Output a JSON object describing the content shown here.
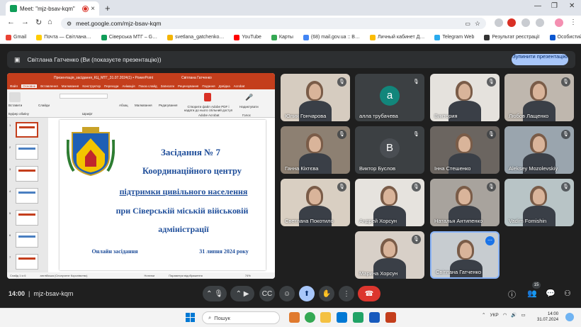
{
  "browser": {
    "tab_title": "Meet: \"mjz-bsav-kqm\"",
    "url": "meet.google.com/mjz-bsav-kqm",
    "new_tab": "+",
    "close": "×"
  },
  "bookmarks": [
    {
      "label": "Gmail",
      "color": "#ea4335"
    },
    {
      "label": "Почта — Світлана…",
      "color": "#ffcc00"
    },
    {
      "label": "Сіверська МТГ – G…",
      "color": "#0f9d58"
    },
    {
      "label": "svetlana_gatchenko…",
      "color": "#f4b400"
    },
    {
      "label": "YouTube",
      "color": "#ff0000"
    },
    {
      "label": "Карты",
      "color": "#34a853"
    },
    {
      "label": "(68) mail.gov.ua :: B…",
      "color": "#4285f4"
    },
    {
      "label": "Личный кабинет Д…",
      "color": "#fbbc04"
    },
    {
      "label": "Telegram Web",
      "color": "#2aabee"
    },
    {
      "label": "Результат реєстрації",
      "color": "#333333"
    },
    {
      "label": "Особистий кабінет",
      "color": "#0b57d0"
    }
  ],
  "banner": {
    "text": "Світлана Гатченко (Ви (показуєте презентацію))",
    "stop_label": "Зупинити презентацію"
  },
  "powerpoint": {
    "title_bar": "Презентація_засідання_КЦ_МТГ_31.07.2024(1) • PowerPoint",
    "user": "Світлана Гатченко",
    "tabs": [
      "Файл",
      "Основне",
      "Вставлення",
      "Малювання",
      "Конструктор",
      "Переходи",
      "Анімація",
      "Показ слайд",
      "Записати",
      "Рецензування",
      "Подання",
      "Довідка",
      "Acrobat"
    ],
    "active_tab": "Основне",
    "ribbon": {
      "paste": "Вставити",
      "clipboard": "Буфер обміну",
      "slides": "Слайди",
      "font": "Шрифт",
      "paragraph": "Абзац",
      "drawing": "Малювання",
      "editing": "Редагування",
      "acrobat": "Створити файл Adobe PDF і надати до нього спільний доступ",
      "acrobat_group": "Adobe Acrobat",
      "dictation": "Надиктувати",
      "voice": "Голос"
    },
    "slide_numbers": [
      "1",
      "2",
      "3",
      "4",
      "5",
      "6",
      "7"
    ],
    "slide": {
      "line1": "Засідання  № 7",
      "line2": "Координаційного центру",
      "line3": "підтримки цивільного населення",
      "line4": "при Сіверській міській військовій",
      "line5": "адміністрації",
      "footer_left": "Онлайн засідання",
      "footer_right": "31 липня 2024 року"
    },
    "status": {
      "slide": "Слайд 1 із 6",
      "lang": "англійська (Сполучене Королівство)",
      "notes": "Нотатки",
      "display": "Параметри відображення",
      "zoom": "74%"
    }
  },
  "participants": [
    {
      "name": "Юлия Гончарова",
      "avatar": "",
      "bg": "#d6ccc0"
    },
    {
      "name": "алла трубачева",
      "avatar": "а",
      "bg": "#3c4043",
      "acolor": "#12867b"
    },
    {
      "name": "Виктория",
      "avatar": "",
      "bg": "#e5e2dd"
    },
    {
      "name": "Любов Лащенко",
      "avatar": "",
      "bg": "#bfb7ae"
    },
    {
      "name": "Ганна Кіхтєва",
      "avatar": "",
      "bg": "#8d8072"
    },
    {
      "name": "Виктор Буслов",
      "avatar": "В",
      "bg": "#3c4043",
      "acolor": "#4a4e53"
    },
    {
      "name": "Інна Стешенко",
      "avatar": "",
      "bg": "#6b6560"
    },
    {
      "name": "Aleksey Mozolevskiy",
      "avatar": "",
      "bg": "#9aa5ae"
    },
    {
      "name": "Светлана Покотило",
      "avatar": "",
      "bg": "#d9cfc2"
    },
    {
      "name": "Андрей Хорсун",
      "avatar": "",
      "bg": "#e6e3de"
    },
    {
      "name": "Наталья Антипенко",
      "avatar": "",
      "bg": "#a8a39d"
    },
    {
      "name": "Vadim Fomishin",
      "avatar": "",
      "bg": "#b8c4c6"
    },
    {
      "name": "Марина Хорсун",
      "avatar": "",
      "bg": "#d8d0c8"
    },
    {
      "name": "Світлана Гатченко",
      "avatar": "",
      "bg": "#c7ccd0"
    }
  ],
  "meeting": {
    "time": "14:00",
    "code": "mjz-bsav-kqm",
    "participant_count": "15"
  },
  "taskbar": {
    "search": "Пошук",
    "lang": "УКР",
    "time": "14:00",
    "date": "31.07.2024"
  }
}
